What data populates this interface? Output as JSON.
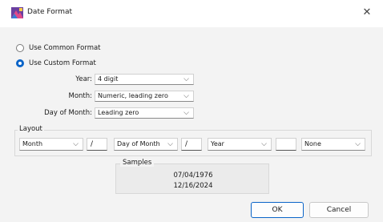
{
  "window": {
    "title": "Date Format",
    "icon": "date-format-app-icon",
    "close_glyph": "✕"
  },
  "format_mode": {
    "common_label": "Use Common Format",
    "custom_label": "Use Custom Format",
    "selected": "custom"
  },
  "fields": {
    "year_label": "Year:",
    "year_value": "4 digit",
    "month_label": "Month:",
    "month_value": "Numeric, leading zero",
    "day_label": "Day of Month:",
    "day_value": "Leading zero"
  },
  "layout": {
    "legend": "Layout",
    "part1": "Month",
    "sep1": "/",
    "part2": "Day of Month",
    "sep2": "/",
    "part3": "Year",
    "sep3": "",
    "part4": "None"
  },
  "samples": {
    "legend": "Samples",
    "line1": "07/04/1976",
    "line2": "12/16/2024"
  },
  "buttons": {
    "ok": "OK",
    "cancel": "Cancel"
  },
  "colors": {
    "accent": "#0a64c8",
    "background": "#f3f3f3",
    "titlebar": "#ffffff"
  }
}
